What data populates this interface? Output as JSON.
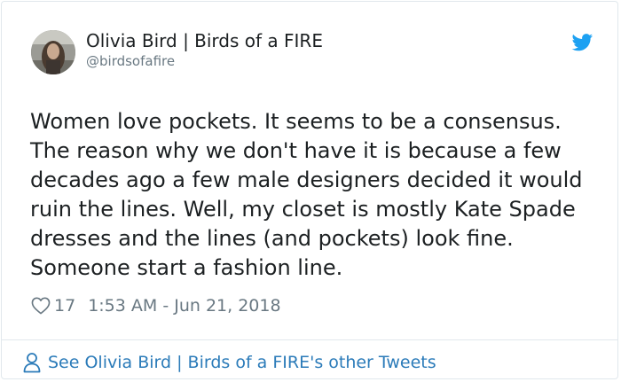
{
  "author": {
    "name": "Olivia Bird | Birds of a FIRE",
    "handle": "@birdsofafire"
  },
  "tweet": {
    "text": "Women love pockets. It seems to be a consensus.\nThe reason why we don't have it is because a few\ndecades ago a few male designers decided it would\nruin the lines. Well, my closet is mostly Kate Spade\ndresses and the lines (and pockets) look fine.\nSomeone start a fashion line.",
    "likes": "17",
    "timestamp": "1:53 AM - Jun 21, 2018"
  },
  "footer": {
    "link_text": "See Olivia Bird | Birds of a FIRE's other Tweets"
  },
  "colors": {
    "twitter_blue": "#1da1f2",
    "link_blue": "#2b7bb9",
    "muted_gray": "#697882",
    "text": "#1c2022"
  },
  "icons": [
    "twitter-bird-icon",
    "heart-icon",
    "person-icon"
  ]
}
